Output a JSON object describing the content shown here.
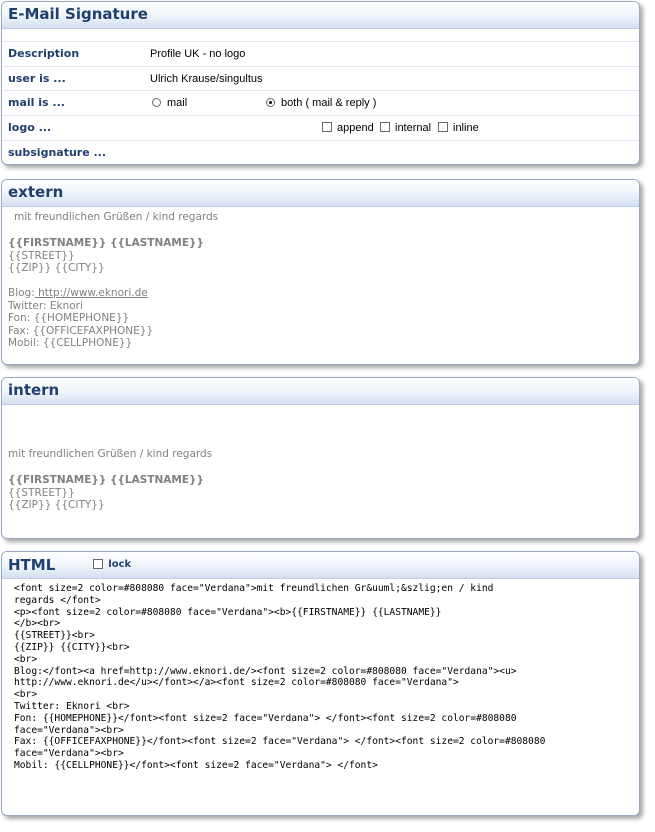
{
  "signature": {
    "title": "E-Mail Signature",
    "rows": {
      "description": {
        "label": "Description",
        "value": "Profile UK - no logo"
      },
      "user": {
        "label": "user is ...",
        "value": "Ulrich Krause/singultus"
      },
      "mail": {
        "label": "mail is ...",
        "option_mail": "mail",
        "option_both": "both ( mail & reply )",
        "selected": "both"
      },
      "logo": {
        "label": "logo ...",
        "options": [
          "append",
          "internal",
          "inline"
        ]
      },
      "subsignature": {
        "label": "subsignature ..."
      }
    }
  },
  "extern": {
    "title": "extern",
    "greeting": "mit freundlichen Grüßen / kind regards",
    "name": "{{FIRSTNAME}} {{LASTNAME}}",
    "street": "{{STREET}}",
    "zipcity": "{{ZIP}} {{CITY}}",
    "blog_label": "Blog:",
    "blog_link": " http://www.eknori.de",
    "twitter": "Twitter: Eknori",
    "fon": "Fon: {{HOMEPHONE}}",
    "fax": "Fax: {{OFFICEFAXPHONE}}",
    "mobil": "Mobil: {{CELLPHONE}}"
  },
  "intern": {
    "title": "intern",
    "greeting": "mit freundlichen Grüßen / kind regards",
    "name": "{{FIRSTNAME}} {{LASTNAME}}",
    "street": "{{STREET}}",
    "zipcity": "{{ZIP}} {{CITY}}"
  },
  "html": {
    "title": "HTML",
    "lock_label": "lock",
    "code_lines": [
      "<font size=2 color=#808080 face=\"Verdana\">mit freundlichen Gr&uuml;&szlig;en / kind",
      "regards </font>",
      "<p><font size=2 color=#808080 face=\"Verdana\"><b>{{FIRSTNAME}} {{LASTNAME}}",
      "</b><br>",
      "{{STREET}}<br>",
      "{{ZIP}} {{CITY}}<br>",
      "<br>",
      "Blog:</font><a href=http://www.eknori.de/><font size=2 color=#808080 face=\"Verdana\"><u>",
      "http://www.eknori.de</u></font></a><font size=2 color=#808080 face=\"Verdana\">",
      "<br>",
      "Twitter: Eknori <br>",
      "Fon: {{HOMEPHONE}}</font><font size=2 face=\"Verdana\"> </font><font size=2 color=#808080",
      "face=\"Verdana\"><br>",
      "Fax: {{OFFICEFAXPHONE}}</font><font size=2 face=\"Verdana\"> </font><font size=2 color=#808080",
      "face=\"Verdana\"><br>",
      "Mobil: {{CELLPHONE}}</font><font size=2 face=\"Verdana\"> </font>"
    ]
  }
}
